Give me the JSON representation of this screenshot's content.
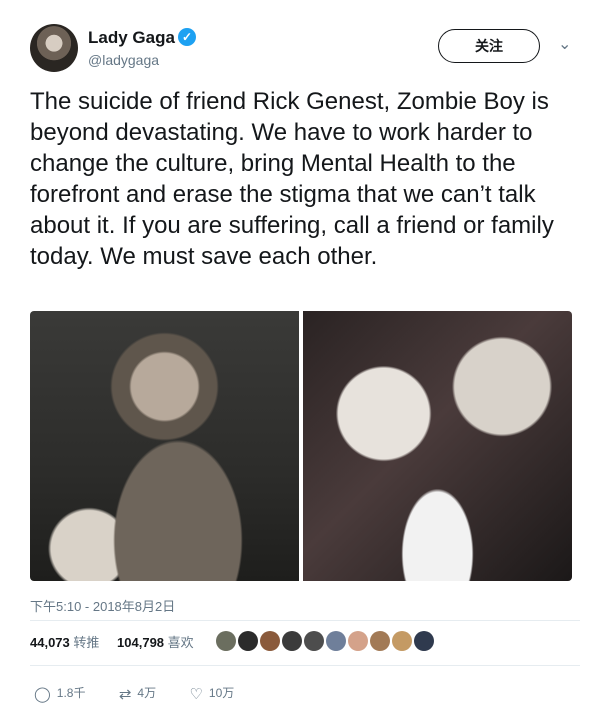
{
  "user": {
    "name": "Lady Gaga",
    "handle": "@ladygaga",
    "verified_icon": "check-icon"
  },
  "follow_label": "关注",
  "tweet_text": "The suicide of friend Rick Genest, Zombie Boy is beyond devastating. We have to work harder to change the culture, bring Mental Health to the forefront and erase the stigma that we can’t talk about it. If you are suffering, call a friend or family today. We must save each other.",
  "timestamp": "下午5:10 - 2018年8月2日",
  "stats": {
    "retweets_count": "44,073",
    "retweets_label": "转推",
    "likes_count": "104,798",
    "likes_label": "喜欢"
  },
  "liker_avatar_colors": [
    "#6b6e5f",
    "#2b2b2b",
    "#8a5a3b",
    "#3b3b3b",
    "#4d4d4d",
    "#6f7f9a",
    "#d4a28a",
    "#a27a56",
    "#c49a64",
    "#2f3a4e"
  ],
  "actions": {
    "reply_count": "1.8千",
    "retweet_count": "4万",
    "like_count": "10万"
  },
  "colors": {
    "verified": "#1da1f2",
    "secondary_text": "#657786"
  }
}
